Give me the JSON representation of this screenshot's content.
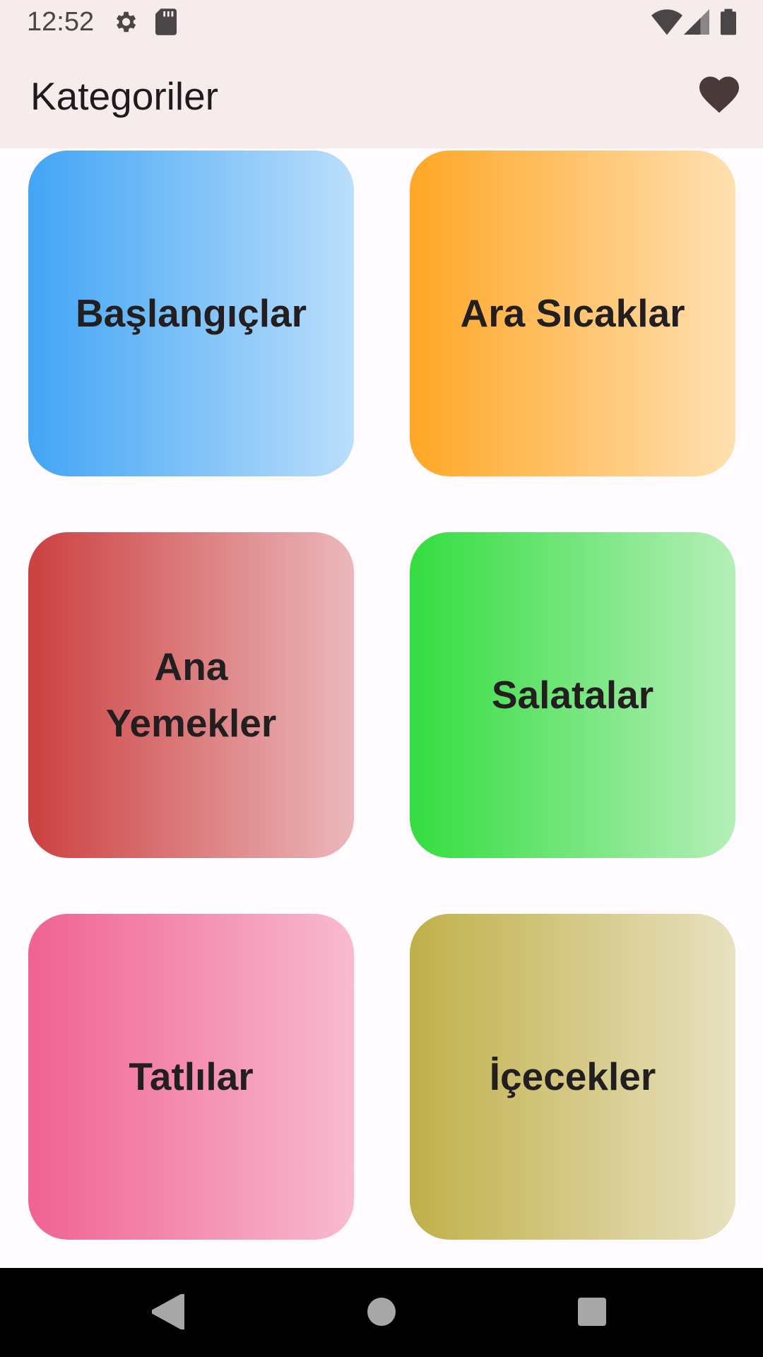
{
  "status_bar": {
    "time": "12:52",
    "icons": [
      "settings-icon",
      "sd-card-icon",
      "wifi-icon",
      "cell-signal-icon",
      "battery-icon"
    ]
  },
  "app_bar": {
    "title": "Kategoriler",
    "action_icon": "heart-icon"
  },
  "categories": [
    {
      "label": "Başlangıçlar",
      "color_start": "#42a5f5",
      "color_end": "#bbdefb"
    },
    {
      "label": "Ara Sıcaklar",
      "color_start": "#ffa726",
      "color_end": "#ffe0b2"
    },
    {
      "label": "Ana Yemekler",
      "color_start": "#cc4040",
      "color_end": "#ebb8bb"
    },
    {
      "label": "Salatalar",
      "color_start": "#33dd40",
      "color_end": "#b5efb8"
    },
    {
      "label": "Tatlılar",
      "color_start": "#f06292",
      "color_end": "#f8bbd0"
    },
    {
      "label": "İçecekler",
      "color_start": "#c0b04a",
      "color_end": "#e8e1c0"
    }
  ],
  "nav_bar": {
    "icons": [
      "back-icon",
      "home-icon",
      "recents-icon"
    ]
  }
}
